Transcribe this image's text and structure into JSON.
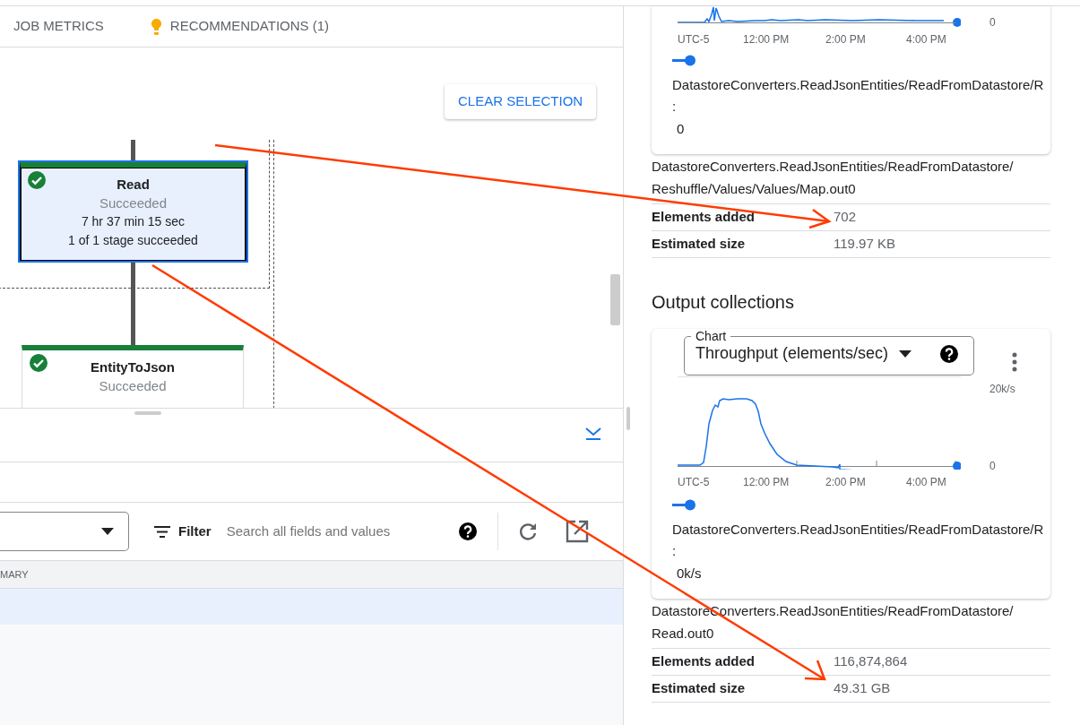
{
  "tabs": [
    {
      "label": "JOB METRICS",
      "kind": "plain"
    },
    {
      "label": "RECOMMENDATIONS (1)",
      "kind": "alert"
    }
  ],
  "clear_selection": "CLEAR SELECTION",
  "graph": {
    "nodes": [
      {
        "name": "Read",
        "status": "Succeeded",
        "duration": "7 hr 37 min 15 sec",
        "stages": "1 of 1 stage succeeded",
        "selected": true
      },
      {
        "name": "EntityToJson",
        "status": "Succeeded",
        "selected": false
      }
    ]
  },
  "bottom_panel": {
    "filter_label": "Filter",
    "search": {
      "placeholder": "Search all fields and values"
    },
    "table": {
      "columns": [
        "MARY"
      ],
      "rows": [
        {
          "selected": true
        }
      ]
    }
  },
  "side_panel": {
    "input_chart": {
      "y_labels": [
        "0"
      ],
      "x_labels": [
        "UTC-5",
        "12:00 PM",
        "2:00 PM",
        "4:00 PM"
      ],
      "legend_name": "DatastoreConverters.ReadJsonEntities/ReadFromDatastore/R",
      "legend_sep": ":",
      "legend_value": "0"
    },
    "input_collection": {
      "name": "DatastoreConverters.ReadJsonEntities/ReadFromDatastore/Reshuffle/Values/Values/Map.out0",
      "stats": [
        {
          "label": "Elements added",
          "value": "702"
        },
        {
          "label": "Estimated size",
          "value": "119.97 KB"
        }
      ]
    },
    "output_heading": "Output collections",
    "output_chart": {
      "select_label": "Chart",
      "select_value": "Throughput (elements/sec)",
      "y_labels": [
        "20k/s",
        "0"
      ],
      "x_labels": [
        "UTC-5",
        "12:00 PM",
        "2:00 PM",
        "4:00 PM"
      ],
      "legend_name": "DatastoreConverters.ReadJsonEntities/ReadFromDatastore/R",
      "legend_sep": ":",
      "legend_value": "0k/s"
    },
    "output_collection": {
      "name": "DatastoreConverters.ReadJsonEntities/ReadFromDatastore/Read.out0",
      "stats": [
        {
          "label": "Elements added",
          "value": "116,874,864"
        },
        {
          "label": "Estimated size",
          "value": "49.31 GB"
        }
      ]
    }
  }
}
